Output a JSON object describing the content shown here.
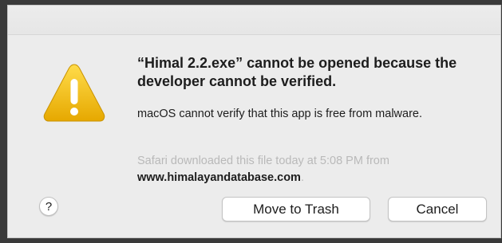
{
  "dialog": {
    "title": "“Himal 2.2.exe” cannot be opened because the developer cannot be verified.",
    "message": "macOS cannot verify that this app is free from malware.",
    "source_prefix": "Safari downloaded this file today at 5:08 PM from",
    "source_domain": "www.himalayandatabase.com",
    "source_suffix": ".",
    "help_label": "?",
    "buttons": {
      "move_to_trash": "Move to Trash",
      "cancel": "Cancel"
    },
    "icon": "warning-triangle-icon",
    "colors": {
      "warning_yellow": "#f5c518",
      "background": "#ececec"
    }
  }
}
